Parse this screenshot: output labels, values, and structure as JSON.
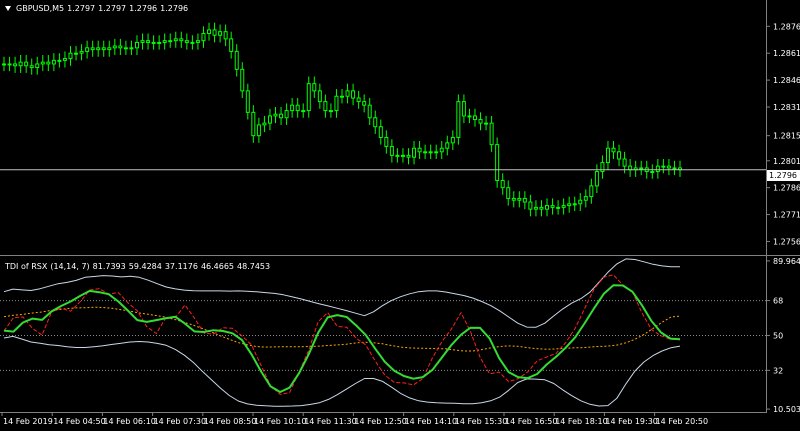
{
  "header": {
    "symbol": "GBPUSD,M5",
    "ohlc": [
      "1.2797",
      "1.2797",
      "1.2796",
      "1.2796"
    ]
  },
  "price_axis": {
    "ticks": [
      "1.2876",
      "1.2861",
      "1.2846",
      "1.2831",
      "1.2815",
      "1.2801",
      "1.2786",
      "1.2771",
      "1.2756"
    ],
    "current_price": "1.2796"
  },
  "indicator": {
    "name": "TDI of RSX",
    "params": "(14,14, 7)",
    "values": [
      "81.7393",
      "59.4284",
      "37.1176",
      "46.4665",
      "48.7453"
    ],
    "axis_max": "89.964",
    "axis_min": "10.5038",
    "levels": [
      "68",
      "50",
      "32"
    ]
  },
  "time_axis": {
    "labels": [
      "14 Feb 2019",
      "14 Feb 04:50",
      "14 Feb 06:10",
      "14 Feb 07:30",
      "14 Feb 08:50",
      "14 Feb 10:10",
      "14 Feb 11:30",
      "14 Feb 12:50",
      "14 Feb 14:10",
      "14 Feb 15:30",
      "14 Feb 16:50",
      "14 Feb 18:10",
      "14 Feb 19:30",
      "14 Feb 20:50"
    ]
  },
  "colors": {
    "background": "#000000",
    "candles": "#00ff00",
    "rsi_line": "#ff2020",
    "signal_line": "#33dd33",
    "band": "#c8d8e8",
    "midband": "#ffa500",
    "level": "#888888",
    "price_line": "#c0c0c0"
  },
  "chart_data": [
    {
      "type": "candlestick",
      "title": "GBPUSD,M5",
      "ylim": [
        1.2749,
        1.2889
      ],
      "series": [
        {
          "name": "GBPUSD,M5",
          "close": [
            1.2855,
            1.2855,
            1.2854,
            1.2856,
            1.2854,
            1.2853,
            1.2855,
            1.2856,
            1.2855,
            1.2857,
            1.2857,
            1.2858,
            1.2861,
            1.2861,
            1.2862,
            1.2864,
            1.2863,
            1.2864,
            1.2863,
            1.2864,
            1.2865,
            1.2864,
            1.2864,
            1.2864,
            1.2867,
            1.2868,
            1.2867,
            1.2867,
            1.2867,
            1.2868,
            1.2868,
            1.2869,
            1.2868,
            1.2867,
            1.2867,
            1.2868,
            1.2872,
            1.2874,
            1.2871,
            1.2873,
            1.2869,
            1.2862,
            1.2852,
            1.284,
            1.2828,
            1.2815,
            1.2821,
            1.2822,
            1.2826,
            1.2827,
            1.2825,
            1.2829,
            1.2832,
            1.2829,
            1.2829,
            1.2844,
            1.284,
            1.2834,
            1.2829,
            1.2829,
            1.2837,
            1.2837,
            1.284,
            1.2836,
            1.2834,
            1.2832,
            1.2825,
            1.282,
            1.2814,
            1.2809,
            1.2804,
            1.2804,
            1.2804,
            1.2803,
            1.2808,
            1.2806,
            1.2806,
            1.2806,
            1.2806,
            1.2808,
            1.2811,
            1.2814,
            1.2834,
            1.2826,
            1.2826,
            1.2824,
            1.2822,
            1.2822,
            1.281,
            1.279,
            1.2786,
            1.278,
            1.2779,
            1.278,
            1.2778,
            1.2774,
            1.2775,
            1.2774,
            1.2776,
            1.2775,
            1.2775,
            1.2776,
            1.2777,
            1.2777,
            1.2779,
            1.2781,
            1.2787,
            1.2795,
            1.28,
            1.2808,
            1.2806,
            1.2802,
            1.2798,
            1.2796,
            1.2797,
            1.2797,
            1.2795,
            1.2795,
            1.2798,
            1.2798,
            1.2797,
            1.2797,
            1.2796
          ]
        }
      ]
    },
    {
      "type": "line",
      "title": "TDI of RSX (14,14, 7)",
      "ylim": [
        10.5038,
        89.964
      ],
      "levels": [
        68,
        50,
        32
      ],
      "series": [
        {
          "name": "upper band",
          "values": [
            72.6,
            73.9,
            73.5,
            73.2,
            74.1,
            75.4,
            76.7,
            77.4,
            78.4,
            80.0,
            80.4,
            80.9,
            80.7,
            80.2,
            80.5,
            80.0,
            78.5,
            76.7,
            75.0,
            74.0,
            73.4,
            73.1,
            73.0,
            73.0,
            73.0,
            72.9,
            73.0,
            72.8,
            72.5,
            72.1,
            71.7,
            71.0,
            69.9,
            68.8,
            67.5,
            66.3,
            65.2,
            64.0,
            62.8,
            61.5,
            60.2,
            62.2,
            65.4,
            68.1,
            70.0,
            71.5,
            72.6,
            73.0,
            73.0,
            72.4,
            71.5,
            70.6,
            69.3,
            67.5,
            65.4,
            62.7,
            59.5,
            56.3,
            54.3,
            54.2,
            56.3,
            60.1,
            63.7,
            66.7,
            69.0,
            72.3,
            77.4,
            82.6,
            86.9,
            89.5,
            89.2,
            88.0,
            86.7,
            85.9,
            85.4,
            85.4
          ]
        },
        {
          "name": "mid band",
          "values": [
            59.7,
            60.4,
            60.8,
            61.5,
            62.0,
            62.7,
            63.3,
            63.9,
            64.2,
            64.3,
            64.6,
            64.4,
            64.0,
            63.3,
            62.5,
            61.6,
            60.9,
            60.2,
            59.4,
            58.2,
            56.8,
            55.3,
            53.6,
            51.8,
            49.8,
            48.0,
            46.3,
            45.1,
            44.3,
            44.0,
            44.1,
            44.2,
            44.2,
            44.2,
            44.3,
            44.5,
            44.8,
            45.1,
            45.5,
            46.1,
            46.5,
            46.2,
            45.7,
            44.8,
            44.0,
            43.6,
            43.4,
            43.3,
            43.2,
            43.1,
            42.5,
            42.0,
            42.0,
            42.7,
            43.6,
            44.3,
            44.6,
            44.4,
            43.8,
            43.2,
            42.9,
            43.0,
            43.3,
            43.6,
            43.7,
            44.0,
            44.3,
            44.5,
            45.0,
            46.2,
            48.0,
            50.5,
            53.6,
            56.8,
            59.5,
            60.0
          ]
        },
        {
          "name": "lower band",
          "values": [
            48.7,
            49.5,
            48.1,
            46.6,
            46.0,
            45.2,
            44.8,
            44.2,
            43.8,
            43.8,
            44.2,
            44.7,
            45.4,
            46.0,
            46.6,
            46.9,
            46.6,
            45.9,
            44.9,
            42.8,
            39.8,
            36.1,
            31.5,
            27.2,
            22.9,
            19.0,
            16.2,
            14.7,
            14.0,
            13.7,
            13.5,
            13.5,
            13.6,
            13.8,
            14.4,
            15.3,
            17.0,
            19.5,
            22.3,
            25.2,
            27.8,
            27.8,
            26.3,
            23.3,
            20.1,
            17.8,
            16.3,
            15.6,
            15.3,
            15.1,
            15.0,
            14.8,
            14.8,
            15.3,
            16.3,
            18.2,
            21.7,
            25.7,
            27.6,
            27.5,
            27.1,
            25.2,
            21.9,
            18.9,
            16.3,
            14.5,
            13.6,
            13.8,
            17.6,
            25.0,
            31.6,
            36.3,
            39.6,
            42.0,
            43.7,
            44.5
          ]
        },
        {
          "name": "RSI",
          "values": [
            52.3,
            59.2,
            59.5,
            53.6,
            50.2,
            62.2,
            64.0,
            62.5,
            67.4,
            73.4,
            74.2,
            71.4,
            72.1,
            66.9,
            62.7,
            54.5,
            51.0,
            59.1,
            59.2,
            65.7,
            59.0,
            51.2,
            50.7,
            54.0,
            53.7,
            49.7,
            45.2,
            34.5,
            24.0,
            19.6,
            20.5,
            31.3,
            42.3,
            57.1,
            61.8,
            54.7,
            54.2,
            48.5,
            45.1,
            36.7,
            29.5,
            25.8,
            25.5,
            24.5,
            27.7,
            38.5,
            46.9,
            53.4,
            61.8,
            52.0,
            38.7,
            30.2,
            31.1,
            26.2,
            27.7,
            31.2,
            36.9,
            38.9,
            40.8,
            46.3,
            53.8,
            64.1,
            74.2,
            80.0,
            81.3,
            76.0,
            72.6,
            61.7,
            53.1,
            49.8,
            48.0,
            47.8
          ]
        },
        {
          "name": "signal",
          "values": [
            52.5,
            52.0,
            56.7,
            58.7,
            58.0,
            62.4,
            65.2,
            67.5,
            70.4,
            73.0,
            72.3,
            71.3,
            67.5,
            62.9,
            57.9,
            57.0,
            57.9,
            58.9,
            59.6,
            56.1,
            52.1,
            51.8,
            52.7,
            52.3,
            51.1,
            47.6,
            40.3,
            31.4,
            23.7,
            20.8,
            23.1,
            30.7,
            40.3,
            51.4,
            59.3,
            60.5,
            59.5,
            55.1,
            50.2,
            43.1,
            36.4,
            31.7,
            29.1,
            27.7,
            28.5,
            32.3,
            38.7,
            45.1,
            50.4,
            54.0,
            53.9,
            48.5,
            38.3,
            31.1,
            28.5,
            28.0,
            30.1,
            35.0,
            39.1,
            43.7,
            49.1,
            56.4,
            64.2,
            71.5,
            75.9,
            75.8,
            72.6,
            65.6,
            57.5,
            51.5,
            48.4,
            48.0
          ]
        }
      ]
    }
  ]
}
